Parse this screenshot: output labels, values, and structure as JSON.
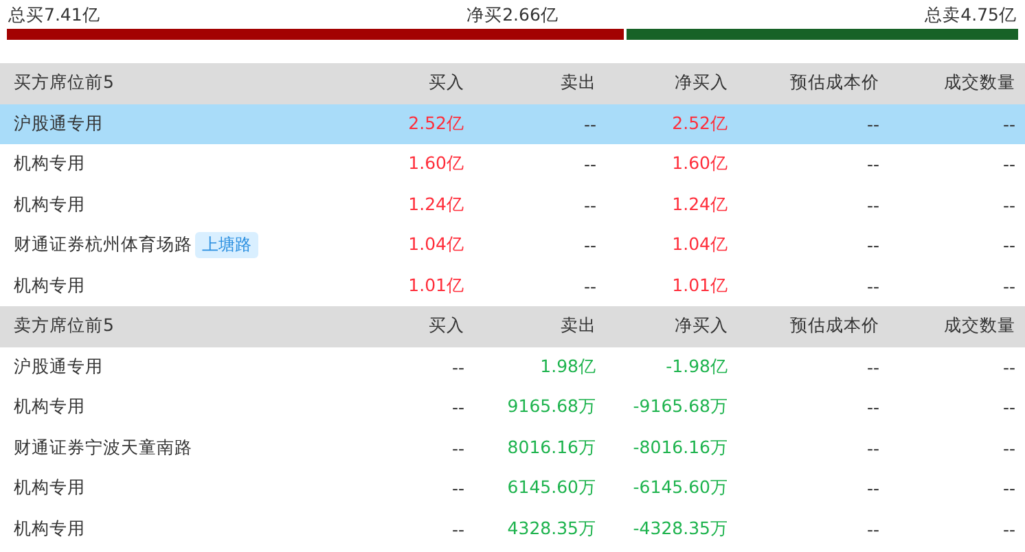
{
  "summary": {
    "total_buy": "总买7.41亿",
    "net_buy": "净买2.66亿",
    "total_sell": "总卖4.75亿",
    "level": 0.61
  },
  "sections": [
    {
      "kind": "buy",
      "title": "买方席位前5",
      "columns": [
        "买入",
        "卖出",
        "净买入",
        "预估成本价",
        "成交数量"
      ],
      "rows": [
        {
          "name": "沪股通专用",
          "selected": true,
          "cells": [
            "2.52亿",
            "--",
            "2.52亿",
            "--",
            "--"
          ]
        },
        {
          "name": "机构专用",
          "selected": false,
          "cells": [
            "1.60亿",
            "--",
            "1.60亿",
            "--",
            "--"
          ]
        },
        {
          "name": "机构专用",
          "selected": false,
          "cells": [
            "1.24亿",
            "--",
            "1.24亿",
            "--",
            "--"
          ]
        },
        {
          "name": "财通证券杭州体育场路",
          "tag": "上塘路",
          "selected": false,
          "cells": [
            "1.04亿",
            "--",
            "1.04亿",
            "--",
            "--"
          ]
        },
        {
          "name": "机构专用",
          "selected": false,
          "cells": [
            "1.01亿",
            "--",
            "1.01亿",
            "--",
            "--"
          ]
        }
      ]
    },
    {
      "kind": "sell",
      "title": "卖方席位前5",
      "columns": [
        "买入",
        "卖出",
        "净买入",
        "预估成本价",
        "成交数量"
      ],
      "rows": [
        {
          "name": "沪股通专用",
          "selected": false,
          "cells": [
            "--",
            "1.98亿",
            "-1.98亿",
            "--",
            "--"
          ]
        },
        {
          "name": "机构专用",
          "selected": false,
          "cells": [
            "--",
            "9165.68万",
            "-9165.68万",
            "--",
            "--"
          ]
        },
        {
          "name": "财通证券宁波天童南路",
          "selected": false,
          "cells": [
            "--",
            "8016.16万",
            "-8016.16万",
            "--",
            "--"
          ]
        },
        {
          "name": "机构专用",
          "selected": false,
          "cells": [
            "--",
            "6145.60万",
            "-6145.60万",
            "--",
            "--"
          ]
        },
        {
          "name": "机构专用",
          "selected": false,
          "cells": [
            "--",
            "4328.35万",
            "-4328.35万",
            "--",
            "--"
          ]
        }
      ]
    }
  ]
}
